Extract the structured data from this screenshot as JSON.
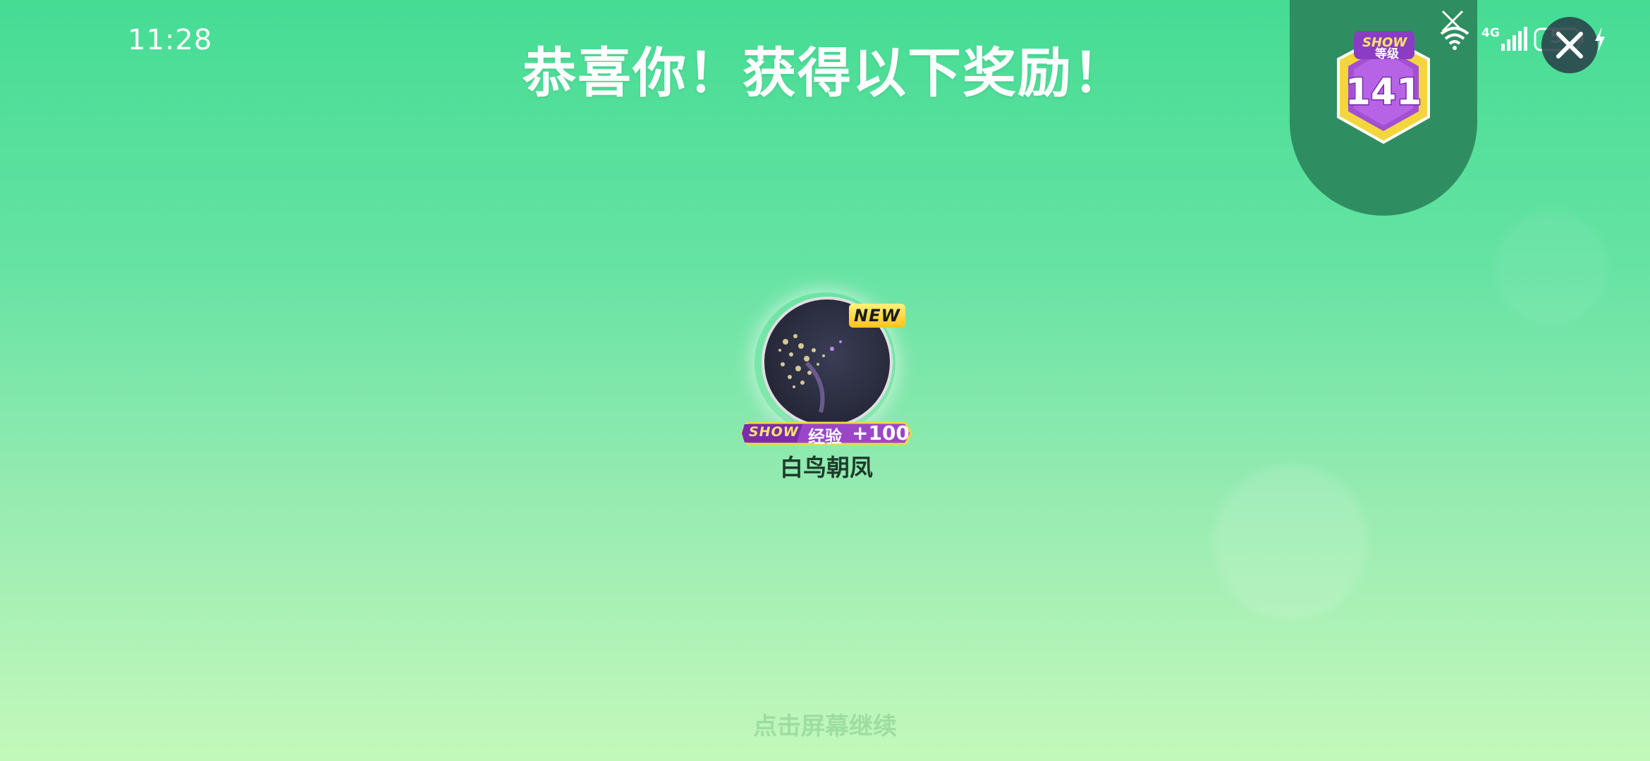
{
  "status_bar": {
    "time": "11:28",
    "network": "4G",
    "battery_level": "5"
  },
  "headline": "恭喜你！获得以下奖励！",
  "level": {
    "badge_brand": "SHOW",
    "badge_title": "等级",
    "value": "141"
  },
  "reward": {
    "new_label": "NEW",
    "exp_brand": "SHOW",
    "exp_label": "经验",
    "exp_value": "+100",
    "name": "白鸟朝凤"
  },
  "hint": "点击屏幕继续",
  "colors": {
    "bg_top": "#45dc94",
    "bg_bottom": "#c4f8bb",
    "level_tab": "#2f8e61",
    "badge_purple": "#a24fd1",
    "badge_gold": "#f3d63e"
  },
  "icons": [
    "wifi-icon",
    "signal-icon",
    "battery-icon",
    "charge-icon",
    "close-icon",
    "level-badge-icon"
  ]
}
